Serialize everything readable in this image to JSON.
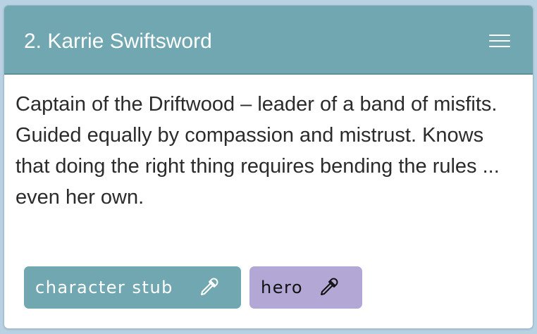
{
  "card": {
    "title": "2. Karrie Swiftsword",
    "menu_icon": "hamburger-menu-icon",
    "description": "Captain of the Driftwood – leader of a band of misfits. Guided equally by compassion and mistrust. Knows that doing the right thing requires bending the rules ... even her own."
  },
  "tags": [
    {
      "label": "character stub",
      "icon": "eyedropper-icon",
      "background": "#71a7b0",
      "text_color": "#ffffff"
    },
    {
      "label": "hero",
      "icon": "eyedropper-icon",
      "background": "#b3a8d5",
      "text_color": "#111111"
    }
  ],
  "colors": {
    "header": "#71a7b0",
    "page_background": "#b9d2e3"
  }
}
